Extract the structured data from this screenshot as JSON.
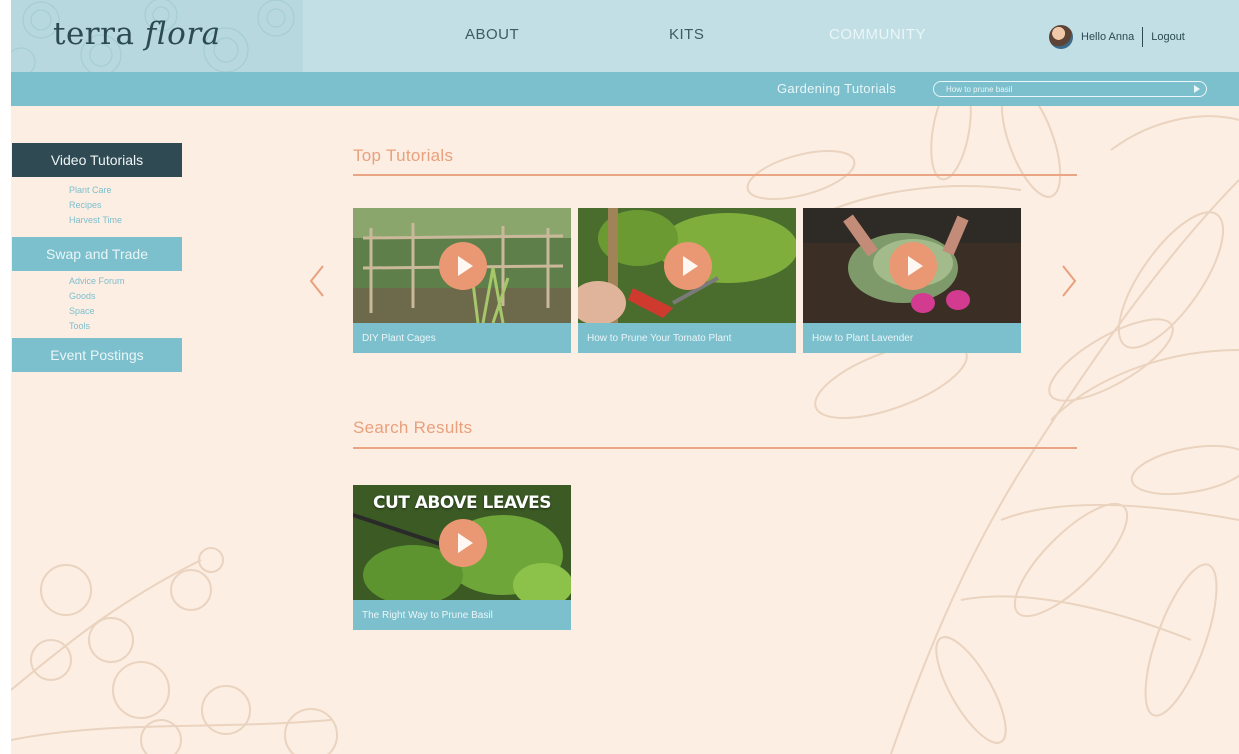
{
  "brand": {
    "logo_main": "terra ",
    "logo_italic": "flora"
  },
  "nav": {
    "about": "ABOUT",
    "kits": "KITS",
    "community": "COMMUNITY"
  },
  "user": {
    "greeting": "Hello Anna",
    "logout": "Logout"
  },
  "subbar": {
    "title": "Gardening Tutorials",
    "search_value": "How to prune basil"
  },
  "sidebar": {
    "video": "Video Tutorials",
    "video_items": [
      "Plant Care",
      "Recipes",
      "Harvest Time"
    ],
    "swap": "Swap and Trade",
    "swap_items": [
      "Advice Forum",
      "Goods",
      "Space",
      "Tools"
    ],
    "events": "Event Postings"
  },
  "top_tutorials": {
    "title": "Top Tutorials",
    "cards": [
      {
        "caption": "DIY Plant Cages"
      },
      {
        "caption": "How to Prune Your Tomato Plant"
      },
      {
        "caption": "How to Plant Lavender"
      }
    ]
  },
  "search_results": {
    "title": "Search Results",
    "cards": [
      {
        "caption": "The Right Way to Prune Basil",
        "overlay": "CUT ABOVE LEAVES"
      }
    ]
  },
  "colors": {
    "header": "#c1dfe5",
    "teal": "#7cbfcd",
    "dark": "#2f4a53",
    "accent": "#e9a07c",
    "page_bg": "#fdeee3"
  }
}
